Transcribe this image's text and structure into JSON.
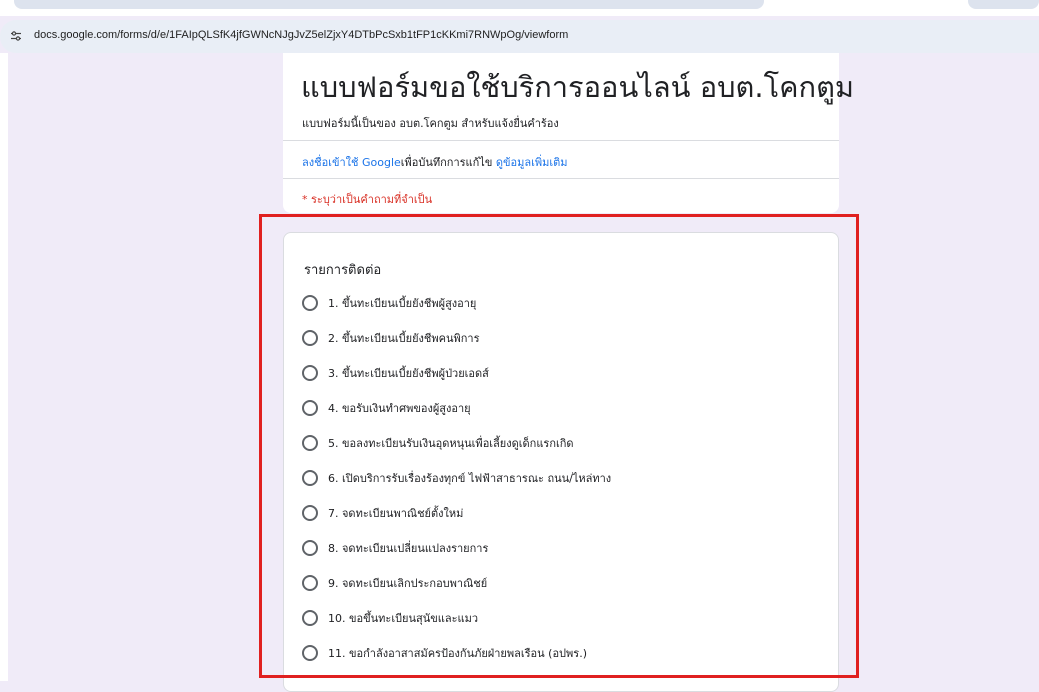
{
  "browser": {
    "url": "docs.google.com/forms/d/e/1FAIpQLSfK4jfGWNcNJgJvZ5elZjxY4DTbPcSxb1tFP1cKKmi7RNWpOg/viewform"
  },
  "form": {
    "title": "แบบฟอร์มขอใช้บริการออนไลน์ อบต.โคกตูม",
    "description": "แบบฟอร์มนี้เป็นของ อบต.โคกตูม สำหรับแจ้งยื่นคำร้อง",
    "signin_link": "ลงชื่อเข้าใช้ Google",
    "signin_text": "เพื่อบันทึกการแก้ไข",
    "learn_more_link": "ดูข้อมูลเพิ่มเติม",
    "required_note": "* ระบุว่าเป็นคำถามที่จำเป็น"
  },
  "question": {
    "title": "รายการติดต่อ",
    "options": [
      "1. ขึ้นทะเบียนเบี้ยยังชีพผู้สูงอายุ",
      "2. ขึ้นทะเบียนเบี้ยยังชีพคนพิการ",
      "3. ขึ้นทะเบียนเบี้ยยังชีพผู้ป่วยเอดส์",
      "4. ขอรับเงินทำศพของผู้สูงอายุ",
      "5. ขอลงทะเบียนรับเงินอุดหนุนเพื่อเลี้ยงดูเด็กแรกเกิด",
      "6. เปิดบริการรับเรื่องร้องทุกข์ ไฟฟ้าสาธารณะ ถนน/ไหล่ทาง",
      "7. จดทะเบียนพาณิชย์ตั้งใหม่",
      "8. จดทะเบียนเปลี่ยนแปลงรายการ",
      "9. จดทะเบียนเลิกประกอบพาณิชย์",
      "10. ขอขึ้นทะเบียนสุนัขและแมว",
      "11. ขอกำลังอาสาสมัครป้องกันภัยฝ่ายพลเรือน (อปพร.)"
    ]
  },
  "colors": {
    "page_bg": "#f0ebf8",
    "highlight": "#e02020",
    "link": "#1a73e8",
    "required": "#d93025"
  },
  "icons": {
    "site_info": "tune-icon",
    "radio": "radio-unchecked-icon"
  }
}
